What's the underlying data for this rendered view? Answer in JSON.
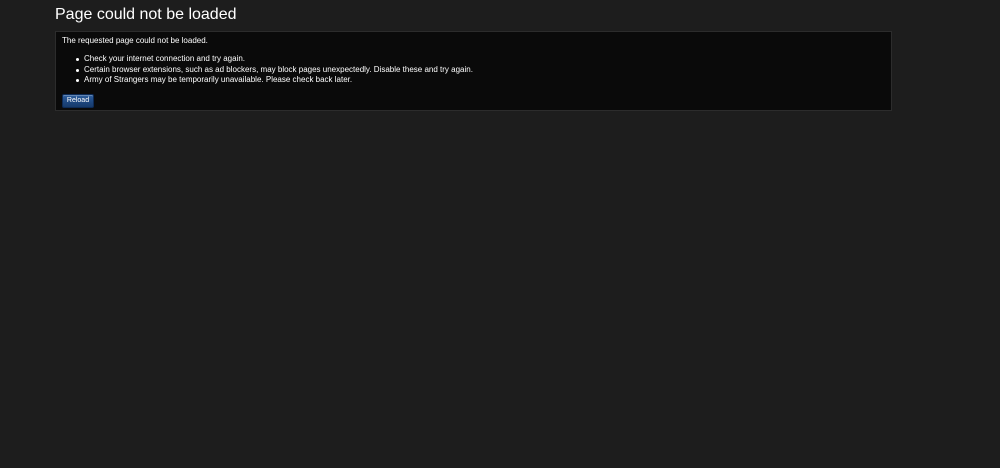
{
  "page": {
    "title": "Page could not be loaded"
  },
  "error": {
    "message": "The requested page could not be loaded.",
    "reasons": [
      "Check your internet connection and try again.",
      "Certain browser extensions, such as ad blockers, may block pages unexpectedly. Disable these and try again.",
      "Army of Strangers may be temporarily unavailable. Please check back later."
    ],
    "reload_label": "Reload"
  },
  "colors": {
    "background": "#1d1d1d",
    "panel": "#0a0a0a",
    "panel_border": "#2c2c2c",
    "button": "#1d4780",
    "text": "#ffffff"
  }
}
